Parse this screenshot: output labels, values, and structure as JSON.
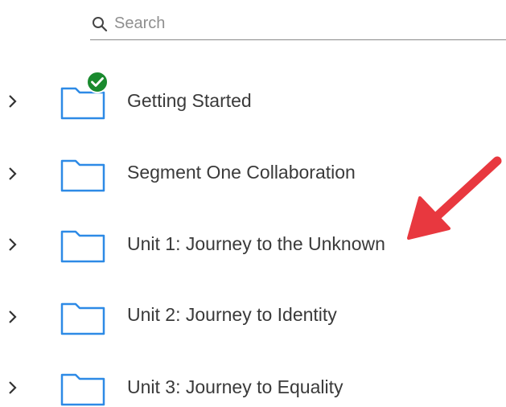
{
  "search": {
    "placeholder": "Search",
    "icon": "search-icon"
  },
  "folders": [
    {
      "label": "Getting Started",
      "icon": "folder-icon",
      "status": "completed",
      "status_color": "#1a8a2e"
    },
    {
      "label": "Segment One Collaboration",
      "icon": "folder-icon"
    },
    {
      "label": "Unit 1: Journey to the Unknown",
      "icon": "folder-icon",
      "annotation": "red-arrow"
    },
    {
      "label": "Unit 2: Journey to Identity",
      "icon": "folder-icon"
    },
    {
      "label": "Unit 3: Journey to Equality",
      "icon": "folder-icon"
    }
  ],
  "colors": {
    "folder_stroke": "#2d8ae6",
    "check_badge": "#1a8a2e",
    "arrow": "#e8383f",
    "text": "#3a3a3a"
  }
}
